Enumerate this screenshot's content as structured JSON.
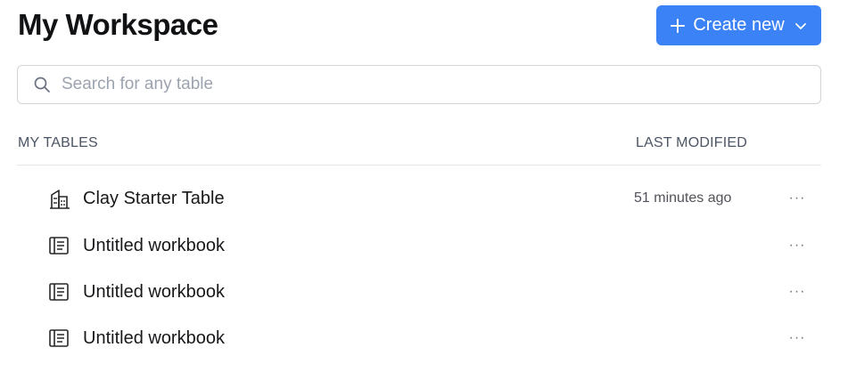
{
  "header": {
    "title": "My Workspace",
    "create_button": {
      "label": "Create new",
      "icon": "plus-icon",
      "dropdown_icon": "chevron-down-icon"
    }
  },
  "search": {
    "placeholder": "Search for any table",
    "value": "",
    "icon": "search-icon"
  },
  "table": {
    "columns": {
      "name": "MY TABLES",
      "modified": "LAST MODIFIED"
    },
    "rows": [
      {
        "icon": "building-icon",
        "name": "Clay Starter Table",
        "modified": "51 minutes ago"
      },
      {
        "icon": "workbook-icon",
        "name": "Untitled workbook",
        "modified": ""
      },
      {
        "icon": "workbook-icon",
        "name": "Untitled workbook",
        "modified": ""
      },
      {
        "icon": "workbook-icon",
        "name": "Untitled workbook",
        "modified": ""
      }
    ]
  },
  "colors": {
    "accent": "#3b82f6",
    "text": "#111214",
    "muted": "#4b5563",
    "border": "#d4d4d8"
  }
}
